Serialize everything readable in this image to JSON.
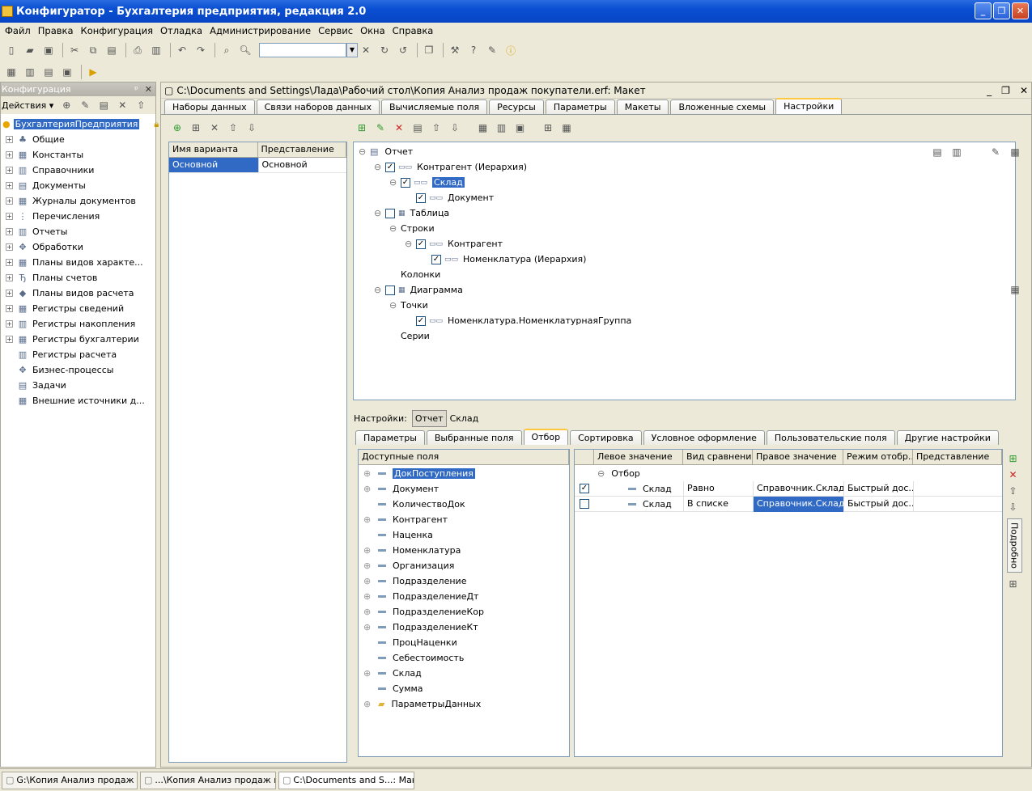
{
  "window": {
    "title": "Конфигуратор - Бухгалтерия предприятия, редакция 2.0",
    "btn_min": "_",
    "btn_max": "❐",
    "btn_close": "✕"
  },
  "menu": [
    "Файл",
    "Правка",
    "Конфигурация",
    "Отладка",
    "Администрирование",
    "Сервис",
    "Окна",
    "Справка"
  ],
  "left_panel": {
    "title": "Конфигурация",
    "pin": "ᵖ",
    "close": "✕",
    "actions": "Действия ▾",
    "items": [
      {
        "label": "БухгалтерияПредприятия",
        "icon": "●"
      },
      {
        "label": "Общие",
        "icon": "♣"
      },
      {
        "label": "Константы",
        "icon": "▦"
      },
      {
        "label": "Справочники",
        "icon": "▥"
      },
      {
        "label": "Документы",
        "icon": "▤"
      },
      {
        "label": "Журналы документов",
        "icon": "▦"
      },
      {
        "label": "Перечисления",
        "icon": "⋮"
      },
      {
        "label": "Отчеты",
        "icon": "▥"
      },
      {
        "label": "Обработки",
        "icon": "✥"
      },
      {
        "label": "Планы видов характе...",
        "icon": "▦"
      },
      {
        "label": "Планы счетов",
        "icon": "Ђ"
      },
      {
        "label": "Планы видов расчета",
        "icon": "◆"
      },
      {
        "label": "Регистры сведений",
        "icon": "▦"
      },
      {
        "label": "Регистры накопления",
        "icon": "▥"
      },
      {
        "label": "Регистры бухгалтерии",
        "icon": "▦"
      },
      {
        "label": "Регистры расчета",
        "icon": "▥"
      },
      {
        "label": "Бизнес-процессы",
        "icon": "✥"
      },
      {
        "label": "Задачи",
        "icon": "▤"
      },
      {
        "label": "Внешние источники д...",
        "icon": "▦"
      }
    ]
  },
  "doc": {
    "title": "C:\\Documents and Settings\\Лада\\Рабочий стол\\Копия Анализ продаж покупатели.erf: Макет",
    "tabs": [
      "Наборы данных",
      "Связи наборов данных",
      "Вычисляемые поля",
      "Ресурсы",
      "Параметры",
      "Макеты",
      "Вложенные схемы",
      "Настройки"
    ],
    "variants": {
      "headers": [
        "Имя варианта",
        "Представление"
      ],
      "rows": [
        [
          "Основной",
          "Основной"
        ]
      ]
    },
    "structure": [
      {
        "label": "Отчет",
        "level": 0,
        "toggle": "⊖",
        "check": null
      },
      {
        "label": "Контрагент (Иерархия)",
        "level": 1,
        "toggle": "⊖",
        "check": true
      },
      {
        "label": "Склад",
        "level": 2,
        "toggle": "⊖",
        "check": true,
        "sel": true
      },
      {
        "label": "Документ",
        "level": 3,
        "toggle": "",
        "check": true
      },
      {
        "label": "Таблица",
        "level": 1,
        "toggle": "⊖",
        "check": false
      },
      {
        "label": "Строки",
        "level": 2,
        "toggle": "⊖",
        "check": null
      },
      {
        "label": "Контрагент",
        "level": 3,
        "toggle": "⊖",
        "check": true
      },
      {
        "label": "Номенклатура (Иерархия)",
        "level": 4,
        "toggle": "",
        "check": true
      },
      {
        "label": "Колонки",
        "level": 2,
        "toggle": "",
        "check": null
      },
      {
        "label": "Диаграмма",
        "level": 1,
        "toggle": "⊖",
        "check": false
      },
      {
        "label": "Точки",
        "level": 2,
        "toggle": "⊖",
        "check": null
      },
      {
        "label": "Номенклатура.НоменклатурнаяГруппа",
        "level": 3,
        "toggle": "",
        "check": true
      },
      {
        "label": "Серии",
        "level": 2,
        "toggle": "",
        "check": null
      }
    ],
    "settings_label": "Настройки:",
    "settings_btns": [
      "Отчет",
      "Склад"
    ],
    "sub_tabs": [
      "Параметры",
      "Выбранные поля",
      "Отбор",
      "Сортировка",
      "Условное оформление",
      "Пользовательские поля",
      "Другие настройки"
    ],
    "fields_header": "Доступные поля",
    "fields": [
      {
        "label": "ДокПоступления",
        "plus": true,
        "sel": true
      },
      {
        "label": "Документ",
        "plus": true
      },
      {
        "label": "КоличествоДок",
        "plus": false
      },
      {
        "label": "Контрагент",
        "plus": true
      },
      {
        "label": "Наценка",
        "plus": false
      },
      {
        "label": "Номенклатура",
        "plus": true
      },
      {
        "label": "Организация",
        "plus": true
      },
      {
        "label": "Подразделение",
        "plus": true
      },
      {
        "label": "ПодразделениеДт",
        "plus": true
      },
      {
        "label": "ПодразделениеКор",
        "plus": true
      },
      {
        "label": "ПодразделениеКт",
        "plus": true
      },
      {
        "label": "ПроцНаценки",
        "plus": false
      },
      {
        "label": "Себестоимость",
        "plus": false
      },
      {
        "label": "Склад",
        "plus": true
      },
      {
        "label": "Сумма",
        "plus": false
      },
      {
        "label": "ПараметрыДанных",
        "plus": true,
        "folder": true
      }
    ],
    "filter_headers": [
      "Левое значение",
      "Вид сравнения",
      "Правое значение",
      "Режим отобр...",
      "Представление"
    ],
    "filter_group": "Отбор",
    "filter_rows": [
      {
        "checked": true,
        "left": "Склад",
        "cmp": "Равно",
        "right": "Справочник.Склад...",
        "mode": "Быстрый дос...",
        "pres": ""
      },
      {
        "checked": false,
        "left": "Склад",
        "cmp": "В списке",
        "right": "Справочник.Склад...",
        "mode": "Быстрый дос...",
        "pres": "",
        "sel": true
      }
    ],
    "side_label": "Подробно"
  },
  "taskbar": [
    "G:\\Копия Анализ продаж п...",
    "...\\Копия Анализ продаж по...",
    "C:\\Documents and S...: Макет"
  ]
}
